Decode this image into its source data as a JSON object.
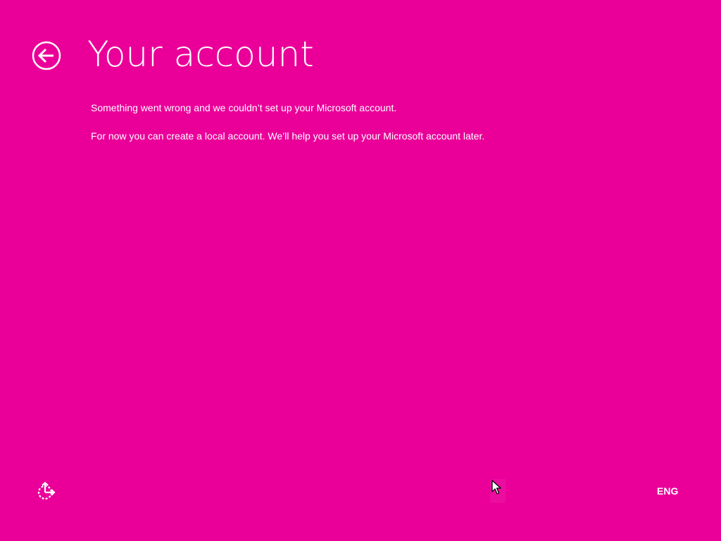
{
  "theme": {
    "background": "#EA0099",
    "foreground": "#ffffff"
  },
  "header": {
    "back_icon": "back-arrow-circle-icon",
    "title": "Your account"
  },
  "messages": [
    "Something went wrong and we couldn’t set up your Microsoft account.",
    "For now you can create a local account. We’ll help you set up your Microsoft account later."
  ],
  "footer": {
    "ease_of_access_icon": "ease-of-access-icon",
    "language": "ENG"
  }
}
